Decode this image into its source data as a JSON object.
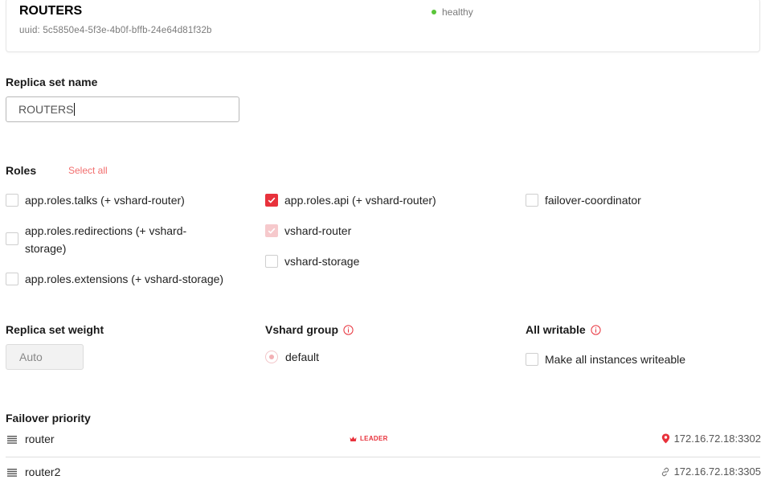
{
  "replicaset": {
    "title": "ROUTERS",
    "uuid": "uuid: 5c5850e4-5f3e-4b0f-bffb-24e64d81f32b",
    "status": "healthy"
  },
  "name_field": {
    "label": "Replica set name",
    "value": "ROUTERS"
  },
  "roles": {
    "label": "Roles",
    "select_all": "Select all",
    "items": [
      {
        "label": "app.roles.talks (+ vshard-router)",
        "state": "unchecked"
      },
      {
        "label": "app.roles.redirections (+ vshard-storage)",
        "state": "unchecked"
      },
      {
        "label": "app.roles.extensions (+ vshard-storage)",
        "state": "unchecked"
      },
      {
        "label": "app.roles.api (+ vshard-router)",
        "state": "checked"
      },
      {
        "label": "vshard-router",
        "state": "checked-disabled"
      },
      {
        "label": "vshard-storage",
        "state": "unchecked"
      },
      {
        "label": "failover-coordinator",
        "state": "unchecked"
      }
    ]
  },
  "weight": {
    "label": "Replica set weight",
    "placeholder": "Auto"
  },
  "vshard_group": {
    "label": "Vshard group",
    "option": "default"
  },
  "all_writable": {
    "label": "All writable",
    "option": "Make all instances writeable"
  },
  "failover": {
    "label": "Failover priority",
    "rows": [
      {
        "name": "router",
        "badge": "LEADER",
        "uri": "172.16.72.18:3302",
        "uri_icon": "location-pin-icon"
      },
      {
        "name": "router2",
        "badge": "",
        "uri": "172.16.72.18:3305",
        "uri_icon": "link-icon"
      }
    ]
  },
  "colors": {
    "accent": "#e8323c",
    "healthy": "#5ac53a",
    "select_all": "#f26d6d"
  }
}
